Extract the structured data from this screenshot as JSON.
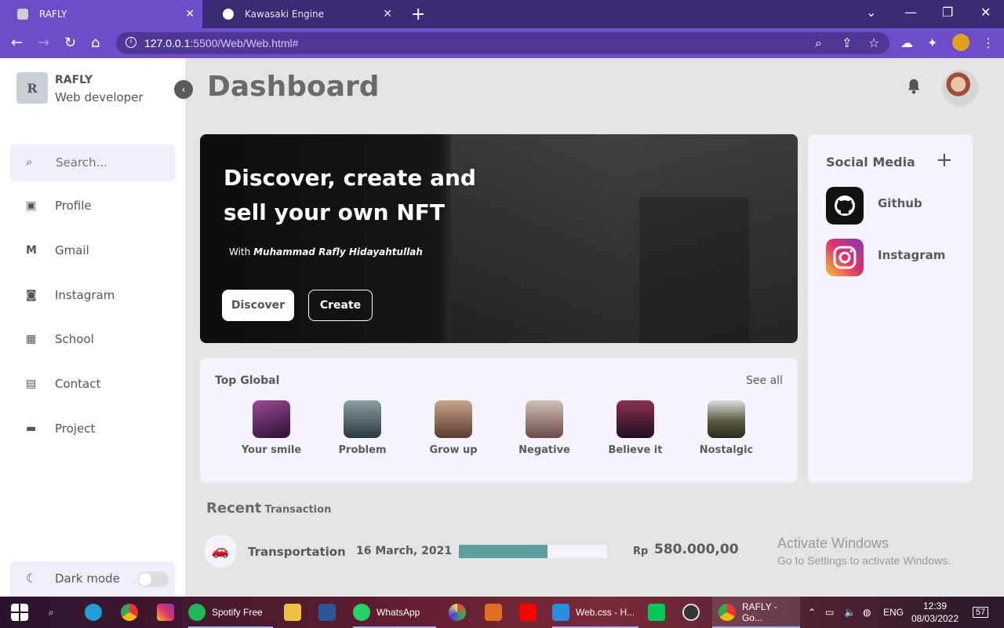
{
  "browser": {
    "tabs": [
      {
        "label": "RAFLY",
        "active": true
      },
      {
        "label": "Kawasaki Engine",
        "active": false
      }
    ],
    "url_host": "127.0.0.1",
    "url_path": ":5500/Web/Web.html#"
  },
  "sidebar": {
    "avatar_letter": "R",
    "user_name": "RAFLY",
    "user_role": "Web developer",
    "search_placeholder": "Search...",
    "items": [
      {
        "label": "Profile",
        "icon": "profile-icon"
      },
      {
        "label": "Gmail",
        "icon": "gmail-icon"
      },
      {
        "label": "Instagram",
        "icon": "instagram-icon"
      },
      {
        "label": "School",
        "icon": "school-icon"
      },
      {
        "label": "Contact",
        "icon": "contact-icon"
      },
      {
        "label": "Project",
        "icon": "briefcase-icon"
      }
    ],
    "dark_mode_label": "Dark mode",
    "dark_mode_on": false
  },
  "main": {
    "title": "Dashboard",
    "hero": {
      "headline": "Discover, create and sell your own NFT",
      "with_prefix": "With",
      "with_name": "Muhammad Rafly Hidayahtullah",
      "discover_label": "Discover",
      "create_label": "Create"
    },
    "social": {
      "heading": "Social Media",
      "items": [
        {
          "label": "Github"
        },
        {
          "label": "Instagram"
        }
      ]
    },
    "top_global": {
      "heading": "Top Global",
      "see_all": "See all",
      "items": [
        {
          "label": "Your smile",
          "color": "#5a2a6a"
        },
        {
          "label": "Problem",
          "color": "#3a4f55"
        },
        {
          "label": "Grow up",
          "color": "#8a6a55"
        },
        {
          "label": "Negative",
          "color": "#7a5a55"
        },
        {
          "label": "Believe it",
          "color": "#4a2440"
        },
        {
          "label": "Nostalgic",
          "color": "#4a4f3a"
        }
      ]
    },
    "recent": {
      "heading": "Recent",
      "subheading": "Transaction",
      "transactions": [
        {
          "category": "Transportation",
          "date": "16 March, 2021",
          "progress": 0.6,
          "currency": "Rp",
          "amount": "580.000,00"
        }
      ]
    },
    "watermark": {
      "line1": "Activate Windows",
      "line2": "Go to Settings to activate Windows."
    }
  },
  "taskbar": {
    "spotify_label": "Spotify Free",
    "whatsapp_label": "WhatsApp",
    "vscode_label": "Web.css - H...",
    "chrome_label": "RAFLY - Go...",
    "language": "ENG",
    "time": "12:39",
    "date": "08/03/2022",
    "notifications": "57"
  },
  "colors": {
    "accent": "#6c4fc8",
    "card_bg": "#f5f3fd",
    "progress": "#5e9ea0"
  }
}
